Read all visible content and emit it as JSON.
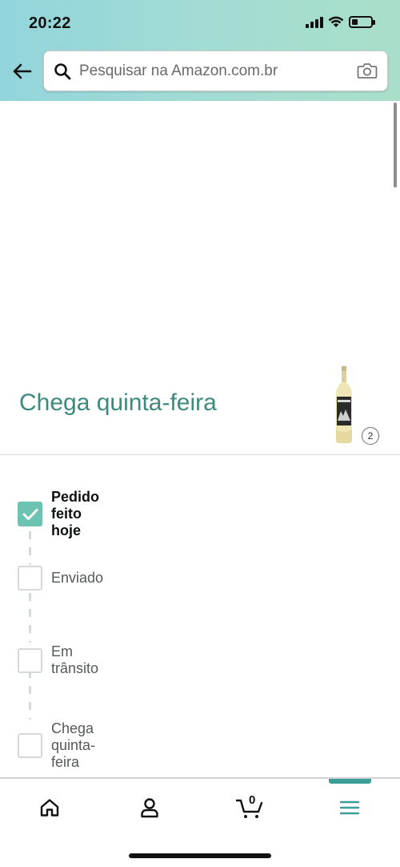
{
  "status_bar": {
    "time": "20:22"
  },
  "search": {
    "placeholder": "Pesquisar na Amazon.com.br"
  },
  "delivery": {
    "title": "Chega quinta-feira",
    "item_quantity": "2"
  },
  "tracker": {
    "steps": [
      {
        "label": "Pedido feito hoje",
        "completed": true
      },
      {
        "label": "Enviado",
        "completed": false
      },
      {
        "label": "Em trânsito",
        "completed": false
      },
      {
        "label": "Chega quinta-feira",
        "completed": false
      }
    ]
  },
  "bottom_nav": {
    "items": [
      {
        "icon": "home-icon"
      },
      {
        "icon": "account-icon"
      },
      {
        "icon": "cart-icon"
      },
      {
        "icon": "menu-icon",
        "active": true
      }
    ],
    "cart_count": "0"
  },
  "colors": {
    "header_gradient_start": "#93d5dc",
    "header_gradient_end": "#a9dfc9",
    "accent_teal": "#3c8a7e",
    "checkbox_done": "#6dc3b2",
    "active_nav": "#3a9e98"
  }
}
